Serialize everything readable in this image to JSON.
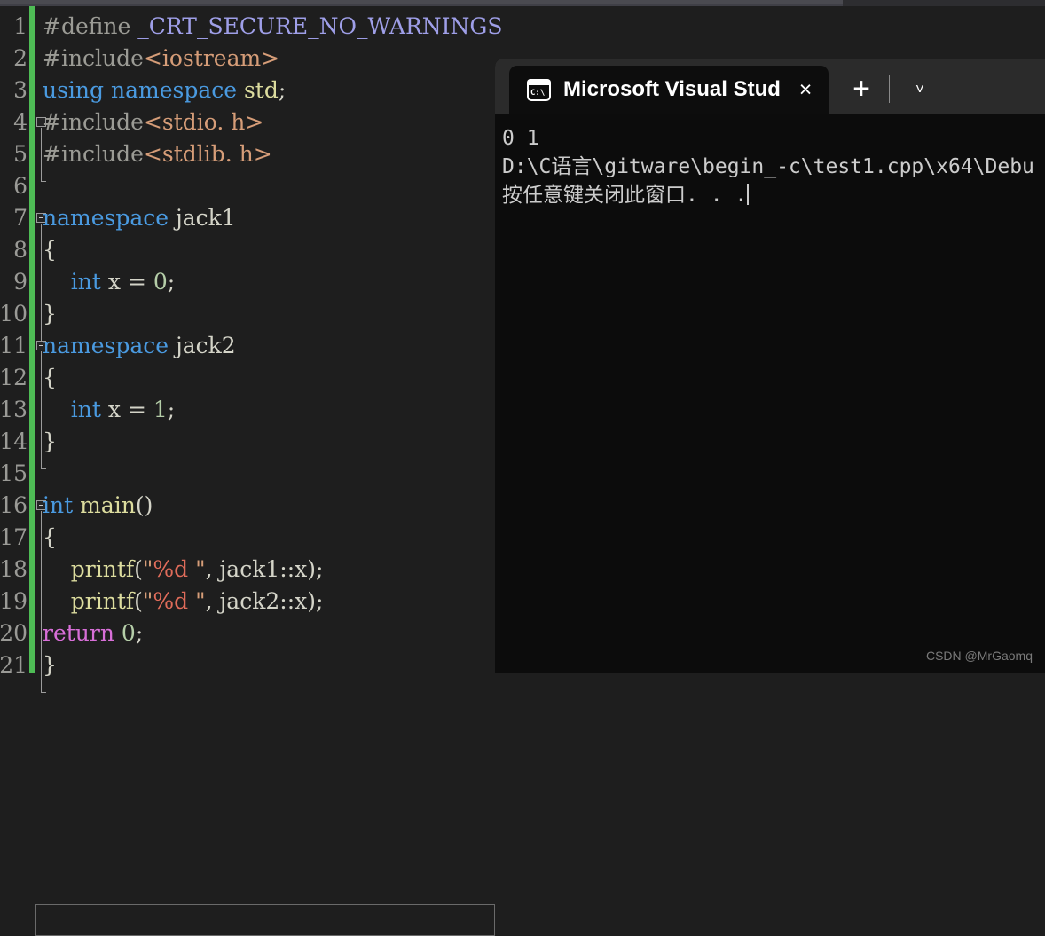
{
  "editor": {
    "language": "cpp",
    "current_line": 29,
    "lines": [
      {
        "n": 1,
        "tokens": [
          {
            "t": "#define ",
            "c": "c-pp"
          },
          {
            "t": "_CRT_SECURE_NO_WARNINGS",
            "c": "c-macro"
          }
        ]
      },
      {
        "n": 2,
        "tokens": [
          {
            "t": "#include",
            "c": "c-pp"
          },
          {
            "t": "<iostream>",
            "c": "c-inc"
          }
        ]
      },
      {
        "n": 3,
        "tokens": [
          {
            "t": "using namespace ",
            "c": "c-kw"
          },
          {
            "t": "std",
            "c": "c-fn"
          },
          {
            "t": ";",
            "c": "c-punct"
          }
        ]
      },
      {
        "n": 4,
        "tokens": [
          {
            "t": "#include",
            "c": "c-pp"
          },
          {
            "t": "<stdio. h>",
            "c": "c-inc"
          }
        ]
      },
      {
        "n": 5,
        "tokens": [
          {
            "t": "#include",
            "c": "c-pp"
          },
          {
            "t": "<stdlib. h>",
            "c": "c-inc"
          }
        ]
      },
      {
        "n": 6,
        "tokens": []
      },
      {
        "n": 7,
        "tokens": [
          {
            "t": "namespace ",
            "c": "c-kw"
          },
          {
            "t": "jack1",
            "c": "c-id"
          }
        ]
      },
      {
        "n": 8,
        "tokens": [
          {
            "t": "{",
            "c": "c-brace"
          }
        ]
      },
      {
        "n": 9,
        "tokens": [
          {
            "t": "    ",
            "c": "c-punct"
          },
          {
            "t": "int",
            "c": "c-kw"
          },
          {
            "t": " x = ",
            "c": "c-id"
          },
          {
            "t": "0",
            "c": "c-num"
          },
          {
            "t": ";",
            "c": "c-punct"
          }
        ]
      },
      {
        "n": 10,
        "tokens": [
          {
            "t": "}",
            "c": "c-brace"
          }
        ]
      },
      {
        "n": 11,
        "tokens": [
          {
            "t": "namespace ",
            "c": "c-kw"
          },
          {
            "t": "jack2",
            "c": "c-id"
          }
        ]
      },
      {
        "n": 12,
        "tokens": [
          {
            "t": "{",
            "c": "c-brace"
          }
        ]
      },
      {
        "n": 13,
        "tokens": [
          {
            "t": "    ",
            "c": "c-punct"
          },
          {
            "t": "int",
            "c": "c-kw"
          },
          {
            "t": " x = ",
            "c": "c-id"
          },
          {
            "t": "1",
            "c": "c-num"
          },
          {
            "t": ";",
            "c": "c-punct"
          }
        ]
      },
      {
        "n": 14,
        "tokens": [
          {
            "t": "}",
            "c": "c-brace"
          }
        ]
      },
      {
        "n": 15,
        "tokens": []
      },
      {
        "n": 16,
        "tokens": [
          {
            "t": "int",
            "c": "c-kw"
          },
          {
            "t": " ",
            "c": "c-punct"
          },
          {
            "t": "main",
            "c": "c-fn"
          },
          {
            "t": "()",
            "c": "c-punct"
          }
        ]
      },
      {
        "n": 17,
        "tokens": [
          {
            "t": "{",
            "c": "c-brace"
          }
        ]
      },
      {
        "n": 18,
        "tokens": [
          {
            "t": "    ",
            "c": "c-punct"
          },
          {
            "t": "printf",
            "c": "c-fn"
          },
          {
            "t": "(",
            "c": "c-punct"
          },
          {
            "t": "\"",
            "c": "c-str"
          },
          {
            "t": "%d",
            "c": "c-fmt"
          },
          {
            "t": " \"",
            "c": "c-str"
          },
          {
            "t": ", ",
            "c": "c-punct"
          },
          {
            "t": "jack1",
            "c": "c-id"
          },
          {
            "t": "::",
            "c": "c-punct"
          },
          {
            "t": "x",
            "c": "c-id"
          },
          {
            "t": ");",
            "c": "c-punct"
          }
        ]
      },
      {
        "n": 19,
        "tokens": [
          {
            "t": "    ",
            "c": "c-punct"
          },
          {
            "t": "printf",
            "c": "c-fn"
          },
          {
            "t": "(",
            "c": "c-punct"
          },
          {
            "t": "\"",
            "c": "c-str"
          },
          {
            "t": "%d",
            "c": "c-fmt"
          },
          {
            "t": " \"",
            "c": "c-str"
          },
          {
            "t": ", ",
            "c": "c-punct"
          },
          {
            "t": "jack2",
            "c": "c-id"
          },
          {
            "t": "::",
            "c": "c-punct"
          },
          {
            "t": "x",
            "c": "c-id"
          },
          {
            "t": ");",
            "c": "c-punct"
          }
        ]
      },
      {
        "n": 20,
        "tokens": [
          {
            "t": "return",
            "c": "c-kw2"
          },
          {
            "t": " ",
            "c": "c-punct"
          },
          {
            "t": "0",
            "c": "c-num"
          },
          {
            "t": ";",
            "c": "c-punct"
          }
        ]
      },
      {
        "n": 21,
        "tokens": [
          {
            "t": "}",
            "c": "c-brace"
          }
        ]
      }
    ],
    "line_number_labels": [
      "1",
      "2",
      "3",
      "4",
      "5",
      "6",
      "7",
      "8",
      "9",
      "10",
      "11",
      "12",
      "13",
      "14",
      "15",
      "16",
      "17",
      "18",
      "19",
      "20",
      "21"
    ],
    "fold_markers": [
      {
        "line": 4,
        "state": "expanded",
        "span_lines": 2
      },
      {
        "line": 7,
        "state": "expanded",
        "span_lines": 4
      },
      {
        "line": 11,
        "state": "expanded",
        "span_lines": 4
      },
      {
        "line": 16,
        "state": "expanded",
        "span_lines": 6
      }
    ],
    "change_bar_color": "#4ebc55"
  },
  "console": {
    "tab_title": "Microsoft Visual Stud",
    "tab_icon_label": "C:\\",
    "close_label": "×",
    "new_tab_label": "+",
    "dropdown_label": "˅",
    "output_lines": [
      "0 1",
      "D:\\C语言\\gitware\\begin_-c\\test1.cpp\\x64\\Debu",
      "按任意键关闭此窗口. . ."
    ]
  },
  "watermark": {
    "text": "CSDN @MrGaomq"
  }
}
